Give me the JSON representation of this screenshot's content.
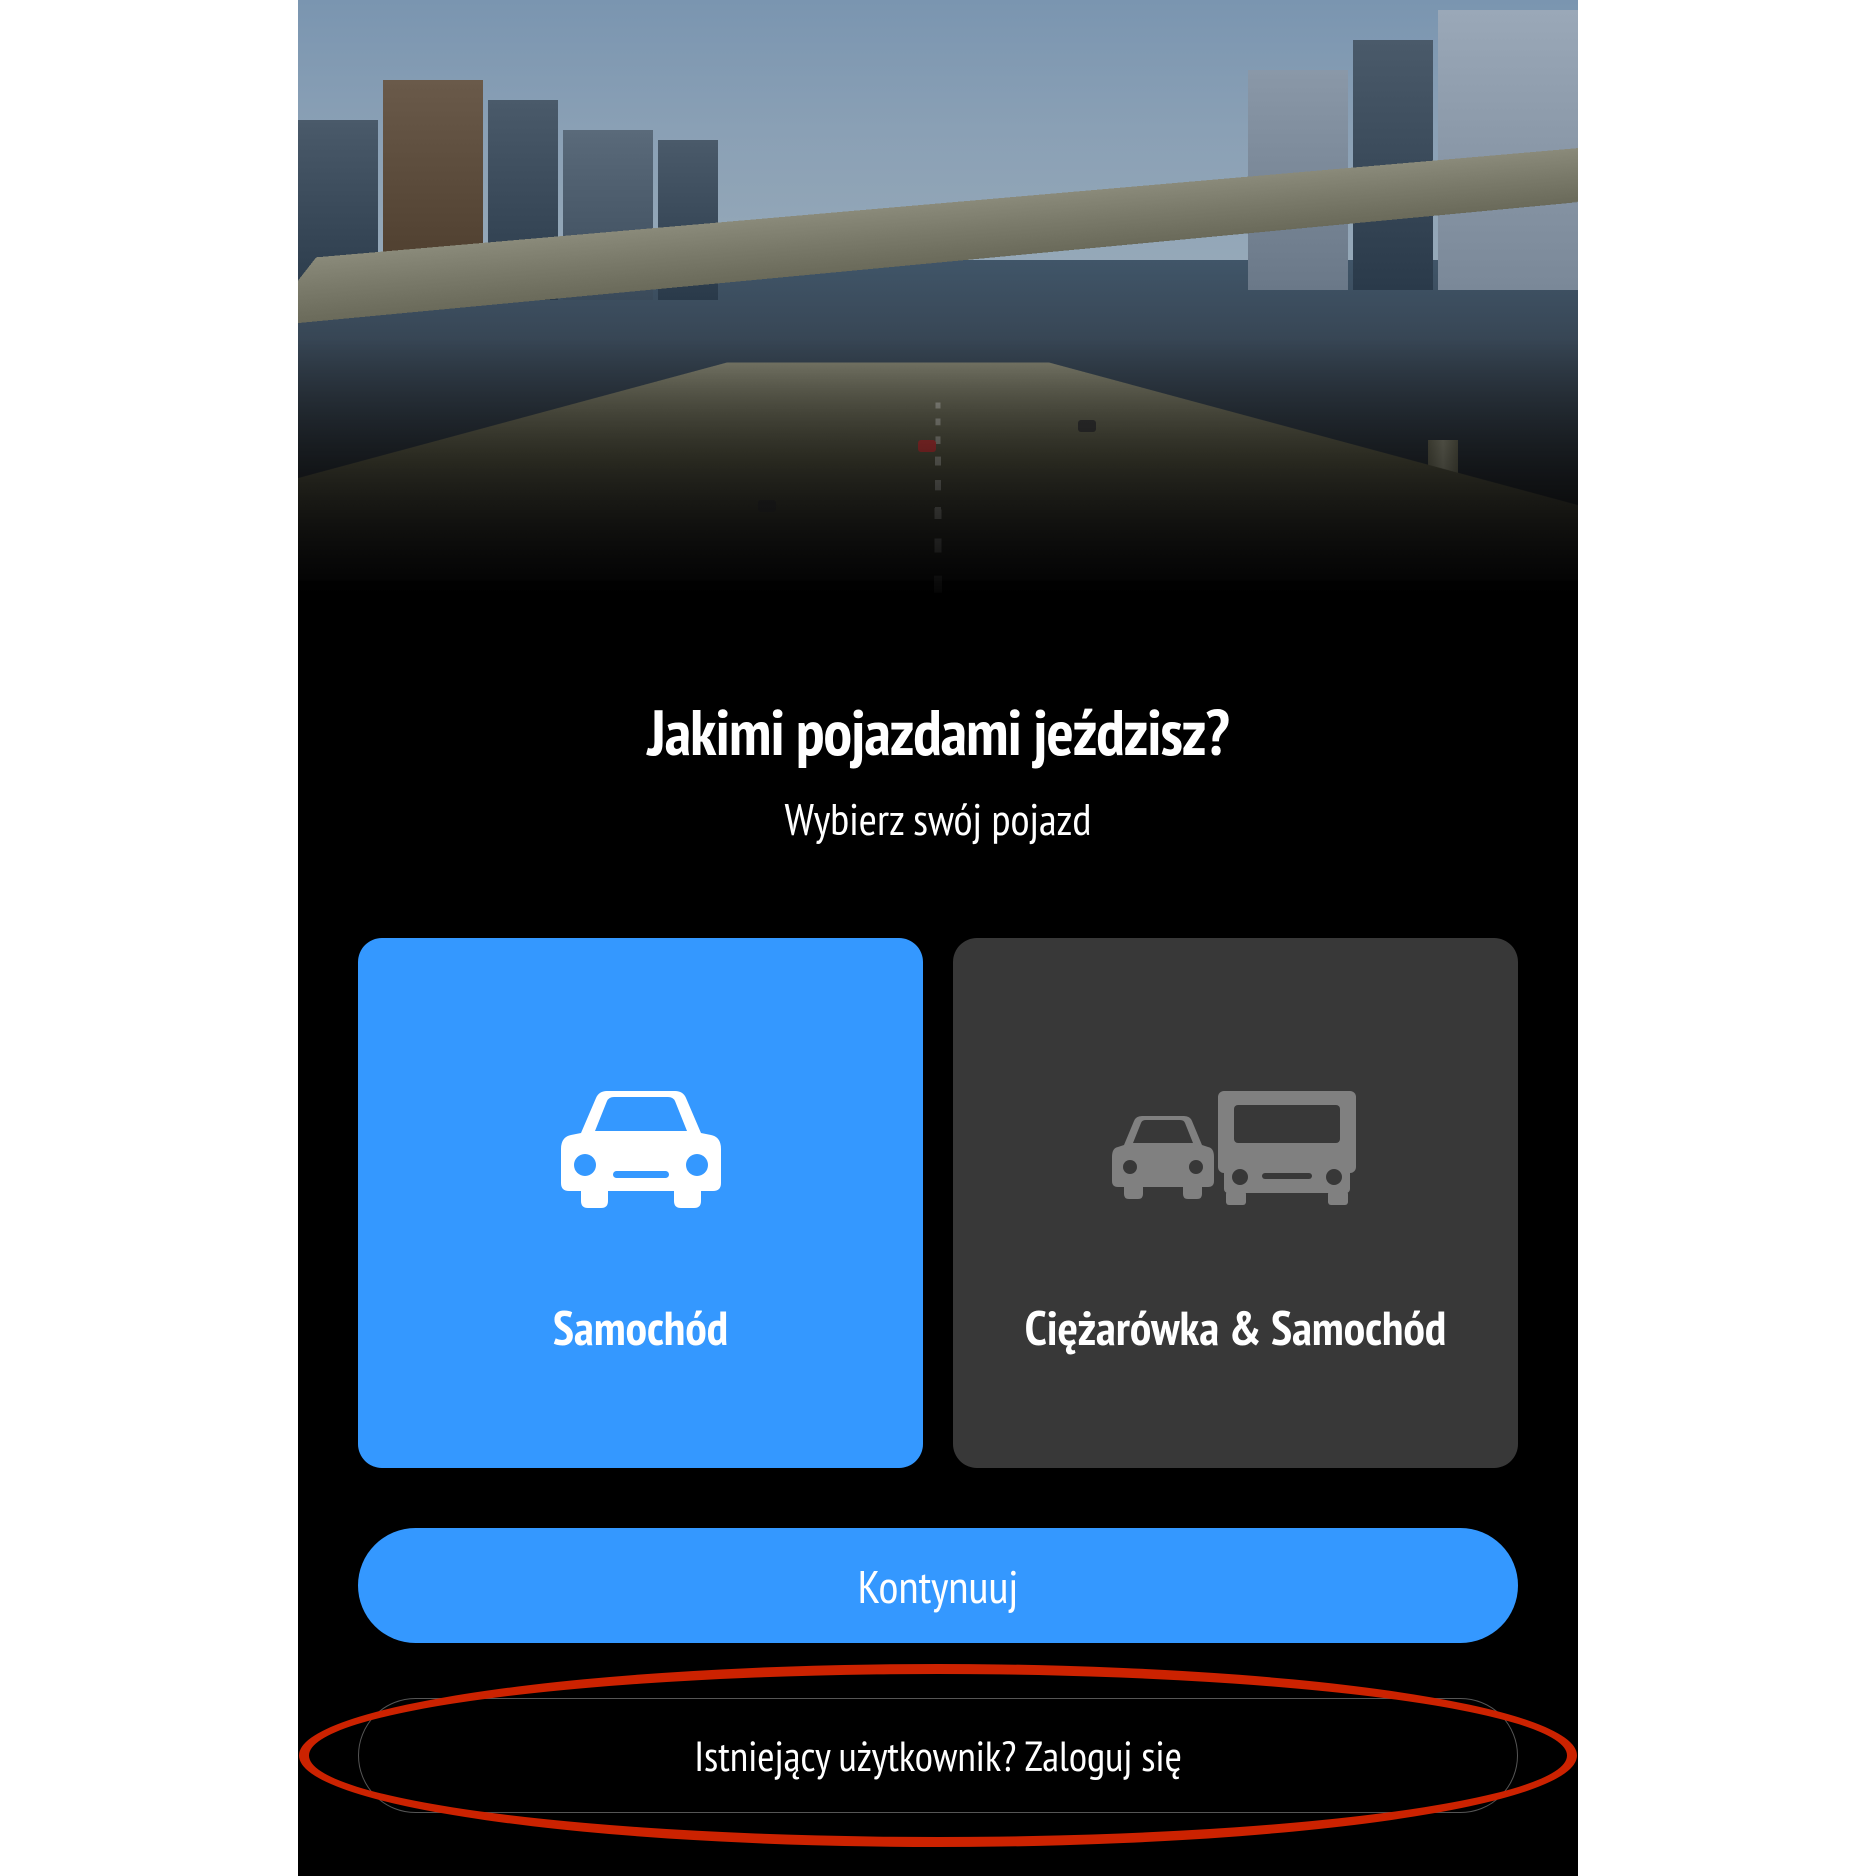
{
  "title": "Jakimi pojazdami jeździsz?",
  "subtitle": "Wybierz swój pojazd",
  "options": [
    {
      "label": "Samochód",
      "icon": "car-icon",
      "selected": true
    },
    {
      "label": "Ciężarówka & Samochód",
      "icon": "truck-car-icon",
      "selected": false
    }
  ],
  "continue_label": "Kontynuuj",
  "signin_label": "Istniejący użytkownik? Zaloguj się",
  "colors": {
    "accent": "#3498ff",
    "card_unselected": "#383838",
    "highlight": "#cc2200"
  }
}
